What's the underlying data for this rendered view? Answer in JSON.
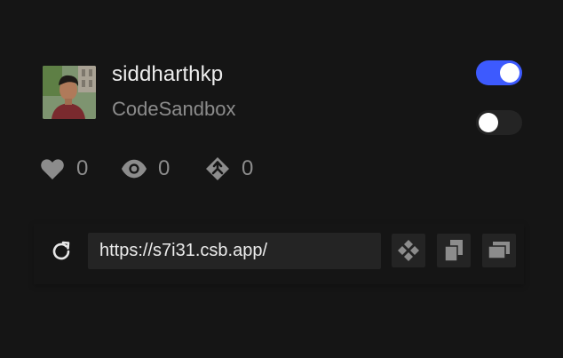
{
  "profile": {
    "username": "siddharthkp",
    "team": "CodeSandbox",
    "avatar_icon": "user-avatar-photo"
  },
  "toggles": [
    {
      "state": "on",
      "accent": "#3d5afe"
    },
    {
      "state": "off"
    }
  ],
  "stats": {
    "likes": "0",
    "views": "0",
    "forks": "0"
  },
  "urlbar": {
    "url": "https://s7i31.csb.app/",
    "refresh_icon": "refresh-icon",
    "buttons": [
      "open-sandbox-icon",
      "copy-icon",
      "new-window-icon"
    ]
  },
  "colors": {
    "background": "#151515",
    "muted": "#8c8c8c",
    "field": "#242424"
  }
}
